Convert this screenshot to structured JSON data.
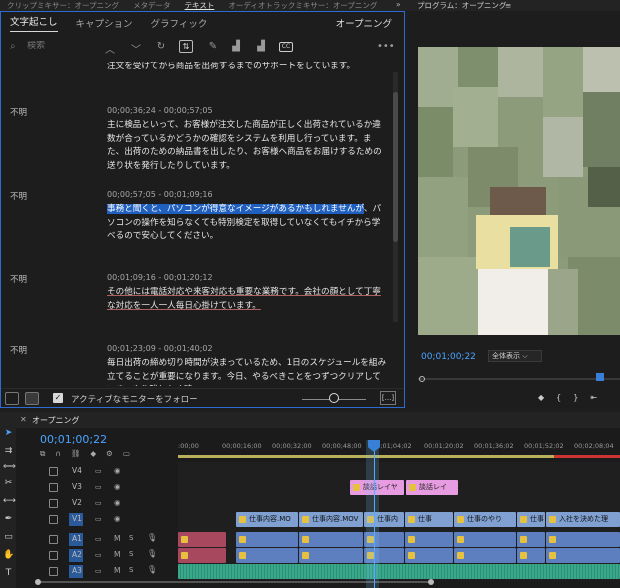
{
  "top_tabs": [
    {
      "label": "クリップミキサー：オープニング"
    },
    {
      "label": "メタデータ"
    },
    {
      "label": "テキスト",
      "active": true
    },
    {
      "label": "オーディオトラックミキサー：オープニング"
    }
  ],
  "program_title": "プログラム：オープニング",
  "sub_tabs": [
    {
      "label": "文字起こし",
      "active": true
    },
    {
      "label": "キャプション"
    },
    {
      "label": "グラフィック"
    }
  ],
  "sequence_label": "オープニング",
  "search": {
    "placeholder": "検索"
  },
  "transcript": [
    {
      "speaker": "",
      "timecode": "",
      "text": "注文を受けてから商品を出荷するまでのサポートをしています。"
    },
    {
      "speaker": "不明",
      "timecode": "00;00;36;24 - 00;00;57;05",
      "text": "主に検品といって、お客様が注文した商品が正しく出荷されているか違数が合っているかどうかの確認をシステムを利用し行っています。また、出荷のための納品書を出したり、お客様へ商品をお届けするための送り状を発行したりしています。"
    },
    {
      "speaker": "不明",
      "timecode": "00;00;57;05 - 00;01;09;16",
      "text_highlight": "事務と聞くと、パソコンが得意なイメージがあるかもしれませんが",
      "text_rest": "、パソコンの操作を知らなくても特別検定を取得していなくてもイチから学べるので安心してください。"
    },
    {
      "speaker": "不明",
      "timecode": "00;01;09;16 - 00;01;20;12",
      "text": "その他には電話対応や来客対応も重要な業務です。会社の顔として丁寧な対応を一人一人毎日心掛けています。"
    },
    {
      "speaker": "不明",
      "timecode": "00;01;23;09 - 00;01;40;02",
      "text": "毎日出荷の締め切り時間が決まっているため、1日のスケジュールを組み立てることが重要になります。今日、やるべきことをつずつクリアしていき、やり残しなく時"
    }
  ],
  "footer": {
    "follow_label": "アクティブなモニターをフォロー",
    "more": "[...]"
  },
  "monitor": {
    "timecode": "00;01;00;22",
    "fit": "全体表示"
  },
  "timeline": {
    "tab": "オープニング",
    "timecode": "00;01;00;22",
    "ruler": [
      ":00;00",
      "00;00;16;00",
      "00;00;32;00",
      "00;00;48;00",
      "00;01;04;02",
      "00;01;20;02",
      "00;01;36;02",
      "00;01;52;02",
      "00;02;08;04"
    ],
    "tracks": [
      {
        "name": "V4"
      },
      {
        "name": "V3"
      },
      {
        "name": "V2"
      },
      {
        "name": "V1"
      },
      {
        "name": "A1",
        "m": "M",
        "s": "S"
      },
      {
        "name": "A2",
        "m": "M",
        "s": "S"
      },
      {
        "name": "A3",
        "m": "M",
        "s": "S"
      }
    ],
    "clips": {
      "title1": "談話レイヤ",
      "title2": "談話レイ",
      "v1": [
        "仕事内容.MO",
        "仕事内容.MOV",
        "仕事内",
        "仕事",
        "仕事のやり",
        "仕事",
        "入社を決めた理"
      ]
    }
  },
  "colors": {
    "accent": "#4aa3ff",
    "highlight": "#1f5fbf",
    "video_clip": "#7fa0d0",
    "title_clip": "#e79be0",
    "audio_green": "#3aa88a"
  }
}
